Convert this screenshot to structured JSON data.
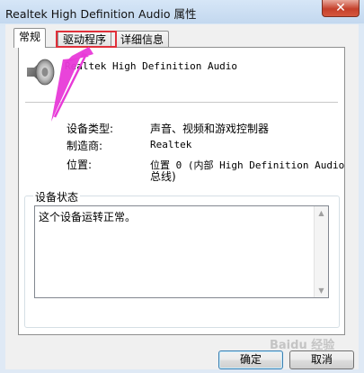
{
  "window": {
    "title": "Realtek High Definition Audio 属性",
    "close_label": "✕"
  },
  "tabs": [
    {
      "label": "常规"
    },
    {
      "label": "驱动程序"
    },
    {
      "label": "详细信息"
    }
  ],
  "device": {
    "name": "Realtek High Definition Audio",
    "icon": "speaker-icon"
  },
  "properties": [
    {
      "label": "设备类型:",
      "value": "声音、视频和游戏控制器"
    },
    {
      "label": "制造商:",
      "value": "Realtek"
    },
    {
      "label": "位置:",
      "value": "位置 0 (内部 High Definition Audio",
      "value_line2": "总线)"
    }
  ],
  "status": {
    "group_title": "设备状态",
    "text": "这个设备运转正常。"
  },
  "buttons": {
    "ok": "确定",
    "cancel": "取消"
  },
  "annotation": {
    "highlight_color": "#e0303a",
    "arrow_color": "#e83ad8"
  },
  "watermark": {
    "text": "Baidu 经验"
  }
}
